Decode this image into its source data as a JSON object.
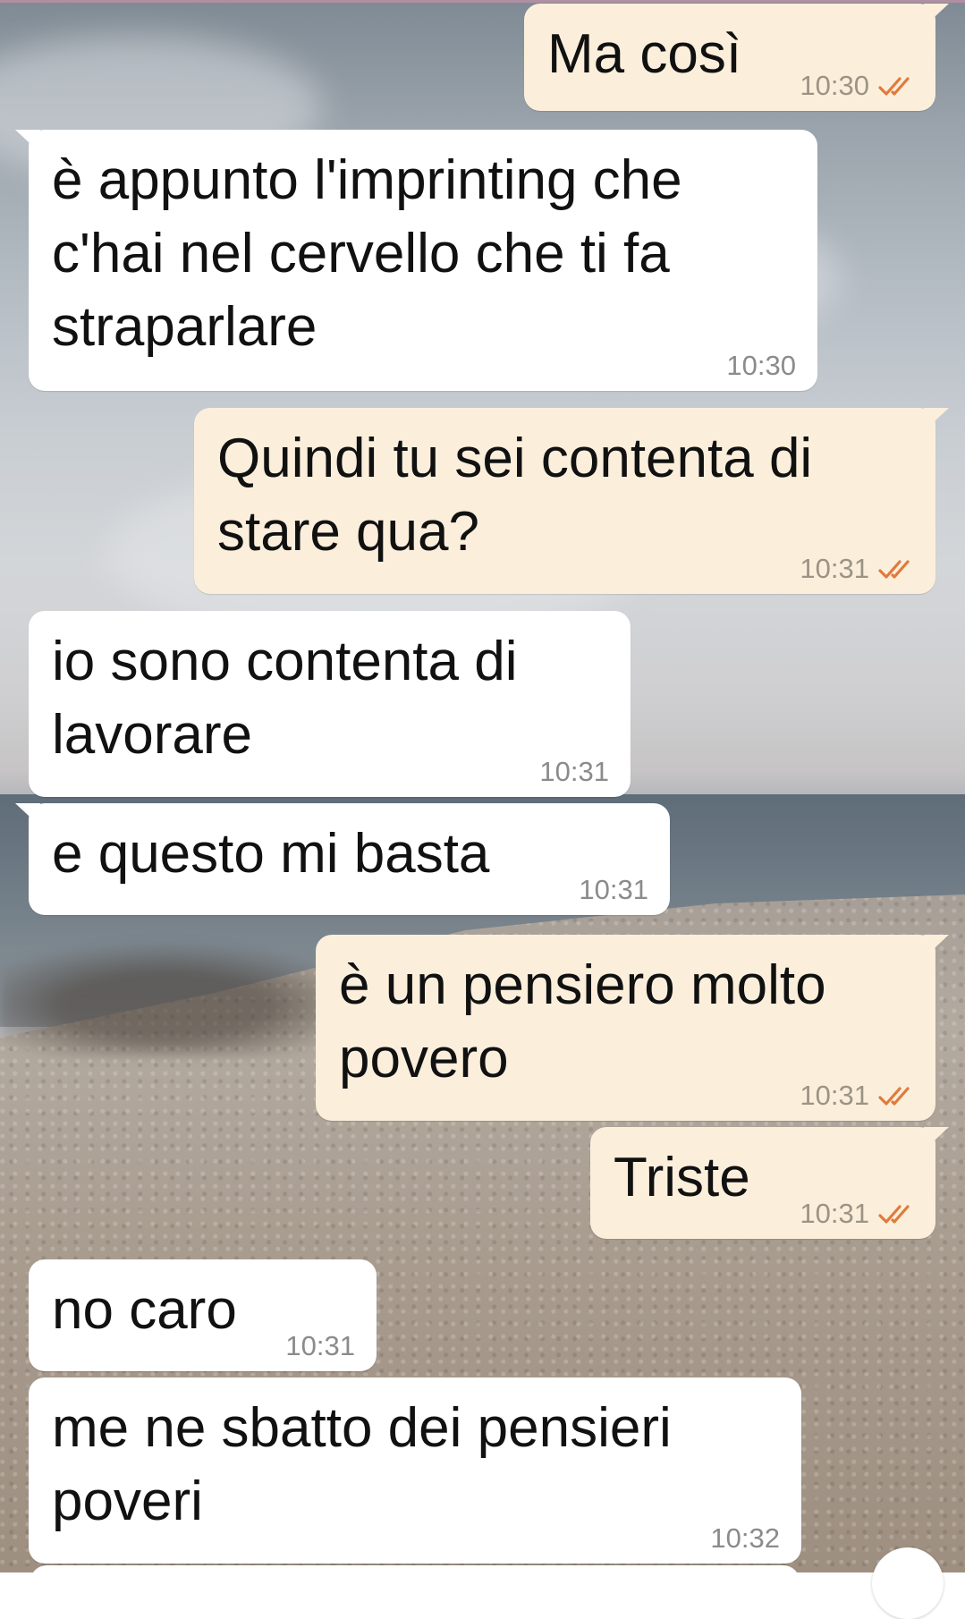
{
  "chat": {
    "wallpaper": "seaside-beach-photo",
    "colors": {
      "incoming_bubble": "#ffffff",
      "outgoing_bubble": "#fbefdc",
      "read_ticks": "#e07a3c",
      "timestamp": "#8b8b8b"
    },
    "messages": [
      {
        "direction": "outgoing",
        "text": "Ma così",
        "time": "10:30",
        "status": "read"
      },
      {
        "direction": "incoming",
        "text": "è appunto l'imprinting che\nc'hai nel cervello che ti fa\nstraparlare",
        "time": "10:30"
      },
      {
        "direction": "outgoing",
        "text": "Quindi tu sei contenta di\nstare qua?",
        "time": "10:31",
        "status": "read"
      },
      {
        "direction": "incoming",
        "text": "io sono contenta di\nlavorare",
        "time": "10:31"
      },
      {
        "direction": "incoming",
        "text": "e questo mi basta",
        "time": "10:31"
      },
      {
        "direction": "outgoing",
        "text": "è un pensiero molto\npovero",
        "time": "10:31",
        "status": "read"
      },
      {
        "direction": "outgoing",
        "text": "Triste",
        "time": "10:31",
        "status": "read"
      },
      {
        "direction": "incoming",
        "text": "no caro",
        "time": "10:31"
      },
      {
        "direction": "incoming",
        "text": "me ne sbatto dei pensieri\npoveri",
        "time": "10:32"
      }
    ]
  }
}
